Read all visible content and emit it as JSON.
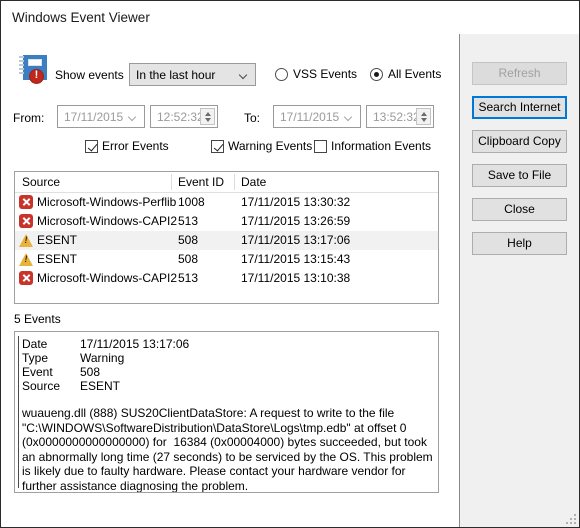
{
  "window": {
    "title": "Windows Event Viewer"
  },
  "filters": {
    "app_icon_name": "event-log-error-icon",
    "show_events_label": "Show events",
    "range_combo": {
      "value": "In the last hour",
      "chevron_icon": "chevron-down-icon"
    },
    "scope_radios": [
      {
        "label": "VSS Events",
        "selected": false
      },
      {
        "label": "All Events",
        "selected": true
      }
    ],
    "from_label": "From:",
    "from_date": "17/11/2015",
    "from_time": "12:52:32",
    "to_label": "To:",
    "to_date": "17/11/2015",
    "to_time": "13:52:32",
    "type_checkboxes": [
      {
        "label": "Error Events",
        "checked": true
      },
      {
        "label": "Warning Events",
        "checked": true
      },
      {
        "label": "Information Events",
        "checked": false
      }
    ]
  },
  "list": {
    "columns": [
      "Source",
      "Event ID",
      "Date"
    ],
    "rows": [
      {
        "icon": "error-icon",
        "source": "Microsoft-Windows-Perflib",
        "event_id": "1008",
        "date": "17/11/2015 13:30:32",
        "selected": false
      },
      {
        "icon": "error-icon",
        "source": "Microsoft-Windows-CAPI2",
        "event_id": "513",
        "date": "17/11/2015 13:26:59",
        "selected": false
      },
      {
        "icon": "warning-icon",
        "source": "ESENT",
        "event_id": "508",
        "date": "17/11/2015 13:17:06",
        "selected": true
      },
      {
        "icon": "warning-icon",
        "source": "ESENT",
        "event_id": "508",
        "date": "17/11/2015 13:15:43",
        "selected": false
      },
      {
        "icon": "error-icon",
        "source": "Microsoft-Windows-CAPI2",
        "event_id": "513",
        "date": "17/11/2015 13:10:38",
        "selected": false
      }
    ],
    "count_label": "5 Events"
  },
  "detail": {
    "fields": [
      {
        "key": "Date",
        "value": "17/11/2015 13:17:06"
      },
      {
        "key": "Type",
        "value": "Warning"
      },
      {
        "key": "Event",
        "value": "508"
      },
      {
        "key": "Source",
        "value": "ESENT"
      }
    ],
    "body": "wuaueng.dll (888) SUS20ClientDataStore: A request to write to the file \"C:\\WINDOWS\\SoftwareDistribution\\DataStore\\Logs\\tmp.edb\" at offset 0 (0x0000000000000000) for  16384 (0x00004000) bytes succeeded, but took an abnormally long time (27 seconds) to be serviced by the OS. This problem is likely due to faulty hardware. Please contact your hardware vendor for further assistance diagnosing the problem."
  },
  "buttons": [
    {
      "label": "Refresh",
      "state": "disabled"
    },
    {
      "label": "Search Internet",
      "state": "focused"
    },
    {
      "label": "Clipboard Copy",
      "state": "normal"
    },
    {
      "label": "Save to File",
      "state": "normal"
    },
    {
      "label": "Close",
      "state": "normal"
    },
    {
      "label": "Help",
      "state": "normal"
    }
  ],
  "colors": {
    "panel_bg": "#f0f0f0",
    "focus_blue": "#0078d7",
    "error_red": "#c9342a",
    "warning_yellow": "#e8b33c",
    "icon_blue": "#3c7ebf"
  }
}
